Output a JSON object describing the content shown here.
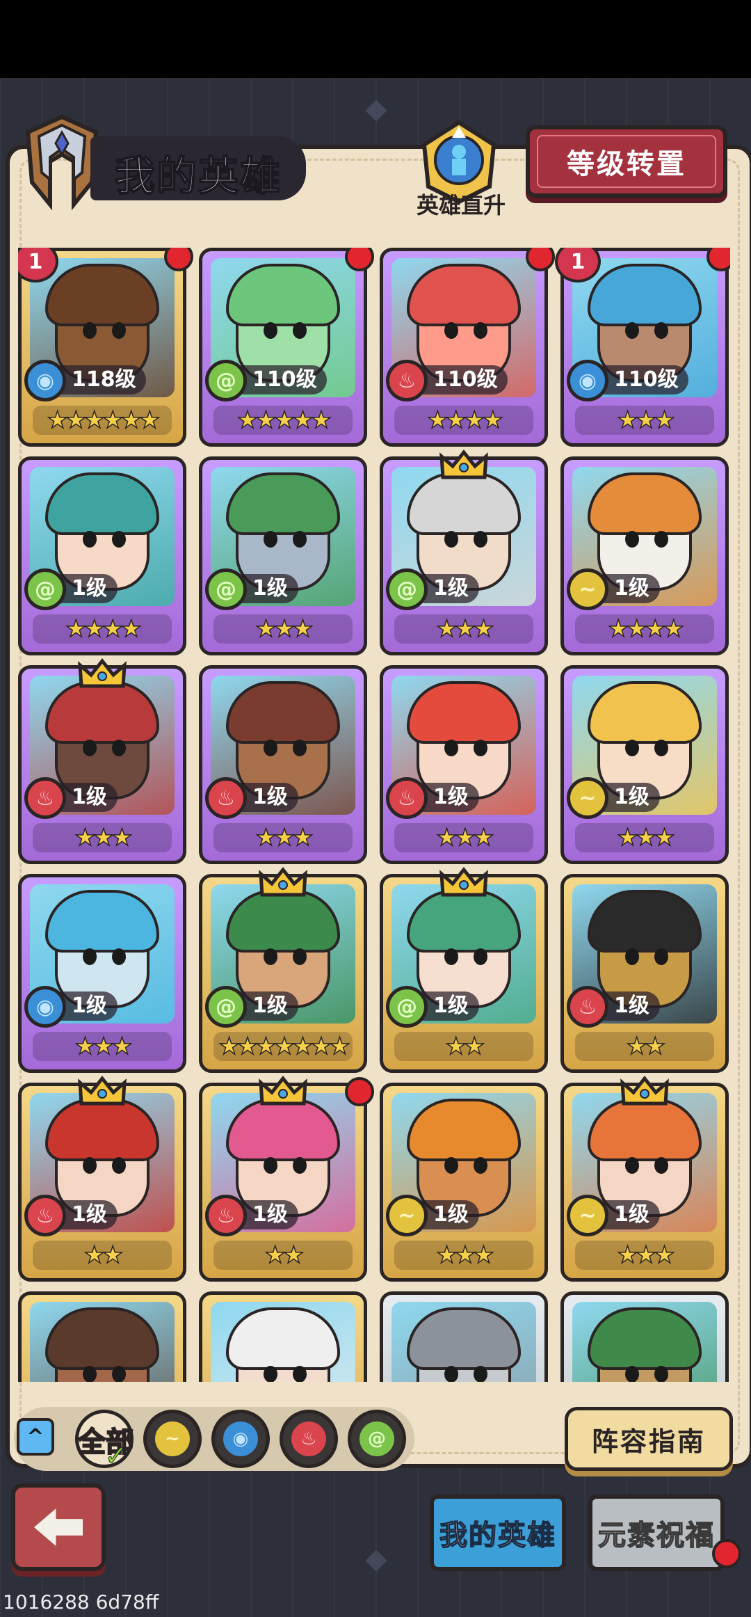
{
  "header": {
    "title": "我的英雄",
    "direct_upgrade_label": "英雄直升",
    "level_reset_label": "等级转置"
  },
  "heroes": [
    {
      "level": "118级",
      "stars": "★★★★★★",
      "element": "water",
      "frame": "gold",
      "badge": "1",
      "reddot": true,
      "palette": [
        "#8a5a34",
        "#6a3f24"
      ]
    },
    {
      "level": "110级",
      "stars": "★★★★★",
      "element": "wood",
      "frame": "purple",
      "badge": "",
      "reddot": true,
      "palette": [
        "#9fe0a8",
        "#6cc77c"
      ]
    },
    {
      "level": "110级",
      "stars": "★★★★",
      "element": "fire",
      "frame": "purple",
      "badge": "",
      "reddot": true,
      "palette": [
        "#ff9b8a",
        "#e1534e"
      ]
    },
    {
      "level": "110级",
      "stars": "★★★",
      "element": "water",
      "frame": "purple",
      "badge": "1",
      "reddot": true,
      "palette": [
        "#b98a6e",
        "#47a7d9"
      ]
    },
    {
      "level": "1级",
      "stars": "★★★★",
      "element": "wood",
      "frame": "purple",
      "badge": "",
      "reddot": false,
      "palette": [
        "#f6d9c7",
        "#3fa3a0"
      ]
    },
    {
      "level": "1级",
      "stars": "★★★",
      "element": "wood",
      "frame": "purple",
      "badge": "",
      "reddot": false,
      "palette": [
        "#a9b8c8",
        "#4a9a5a"
      ]
    },
    {
      "level": "1级",
      "stars": "★★★",
      "element": "wood",
      "frame": "purple",
      "badge": "",
      "reddot": false,
      "crown": true,
      "palette": [
        "#f1dcc9",
        "#d6d6d6"
      ]
    },
    {
      "level": "1级",
      "stars": "★★★★",
      "element": "earth",
      "frame": "purple",
      "badge": "",
      "reddot": false,
      "palette": [
        "#f3f0ea",
        "#e58c3a"
      ]
    },
    {
      "level": "1级",
      "stars": "★★★",
      "element": "fire",
      "frame": "purple",
      "badge": "",
      "reddot": false,
      "crown": true,
      "palette": [
        "#6e4a3e",
        "#b93a3a"
      ]
    },
    {
      "level": "1级",
      "stars": "★★★",
      "element": "fire",
      "frame": "purple",
      "badge": "",
      "reddot": false,
      "palette": [
        "#a8714c",
        "#7a3c2e"
      ]
    },
    {
      "level": "1级",
      "stars": "★★★",
      "element": "fire",
      "frame": "purple",
      "badge": "",
      "reddot": false,
      "palette": [
        "#f8d8c6",
        "#e44b3c"
      ]
    },
    {
      "level": "1级",
      "stars": "★★★",
      "element": "earth",
      "frame": "purple",
      "badge": "",
      "reddot": false,
      "palette": [
        "#f7dcc6",
        "#f2c24e"
      ]
    },
    {
      "level": "1级",
      "stars": "★★★",
      "element": "water",
      "frame": "purple",
      "badge": "",
      "reddot": false,
      "palette": [
        "#cfe6f0",
        "#4db6e0"
      ]
    },
    {
      "level": "1级",
      "stars": "★★★★★★★",
      "element": "wood",
      "frame": "gold",
      "badge": "",
      "reddot": false,
      "crown": true,
      "palette": [
        "#d9a57a",
        "#3c8a4c"
      ]
    },
    {
      "level": "1级",
      "stars": "★★",
      "element": "wood",
      "frame": "gold",
      "badge": "",
      "reddot": false,
      "crown": true,
      "palette": [
        "#f6dfd0",
        "#46a57c"
      ]
    },
    {
      "level": "1级",
      "stars": "★★",
      "element": "fire",
      "frame": "gold",
      "badge": "",
      "reddot": false,
      "palette": [
        "#c79b46",
        "#2a2a2a"
      ]
    },
    {
      "level": "1级",
      "stars": "★★",
      "element": "fire",
      "frame": "gold",
      "badge": "",
      "reddot": false,
      "crown": true,
      "palette": [
        "#f5d6c4",
        "#c8362e"
      ]
    },
    {
      "level": "1级",
      "stars": "★★",
      "element": "fire",
      "frame": "gold",
      "badge": "",
      "reddot": true,
      "crown": true,
      "palette": [
        "#f5d6c4",
        "#e25a8f"
      ]
    },
    {
      "level": "1级",
      "stars": "★★★",
      "element": "earth",
      "frame": "gold",
      "badge": "",
      "reddot": false,
      "palette": [
        "#d98f52",
        "#e68a2d"
      ]
    },
    {
      "level": "1级",
      "stars": "★★★",
      "element": "earth",
      "frame": "gold",
      "badge": "",
      "reddot": false,
      "crown": true,
      "palette": [
        "#f5d6c4",
        "#e7753a"
      ]
    },
    {
      "level": "",
      "stars": "",
      "element": "",
      "frame": "gold",
      "badge": "",
      "reddot": false,
      "palette": [
        "#a3674a",
        "#5a3a2a"
      ]
    },
    {
      "level": "",
      "stars": "",
      "element": "",
      "frame": "gold",
      "badge": "",
      "reddot": false,
      "palette": [
        "#f2dccd",
        "#efefef"
      ]
    },
    {
      "level": "",
      "stars": "",
      "element": "",
      "frame": "silver",
      "badge": "",
      "reddot": false,
      "palette": [
        "#c6cbd0",
        "#8b9299"
      ]
    },
    {
      "level": "",
      "stars": "",
      "element": "",
      "frame": "silver",
      "badge": "",
      "reddot": false,
      "palette": [
        "#c39a62",
        "#3f8a4a"
      ]
    }
  ],
  "filters": {
    "all_label": "全部",
    "elements": [
      "earth",
      "water",
      "fire",
      "wood"
    ]
  },
  "guide_label": "阵容指南",
  "tabs": {
    "my_heroes": "我的英雄",
    "element_blessing": "元素祝福"
  },
  "watermark": "1016288 6d78ff",
  "colors": {
    "water": "#3a8fd6",
    "wood": "#7cc34a",
    "fire": "#d9444d",
    "earth": "#e3c33e"
  }
}
